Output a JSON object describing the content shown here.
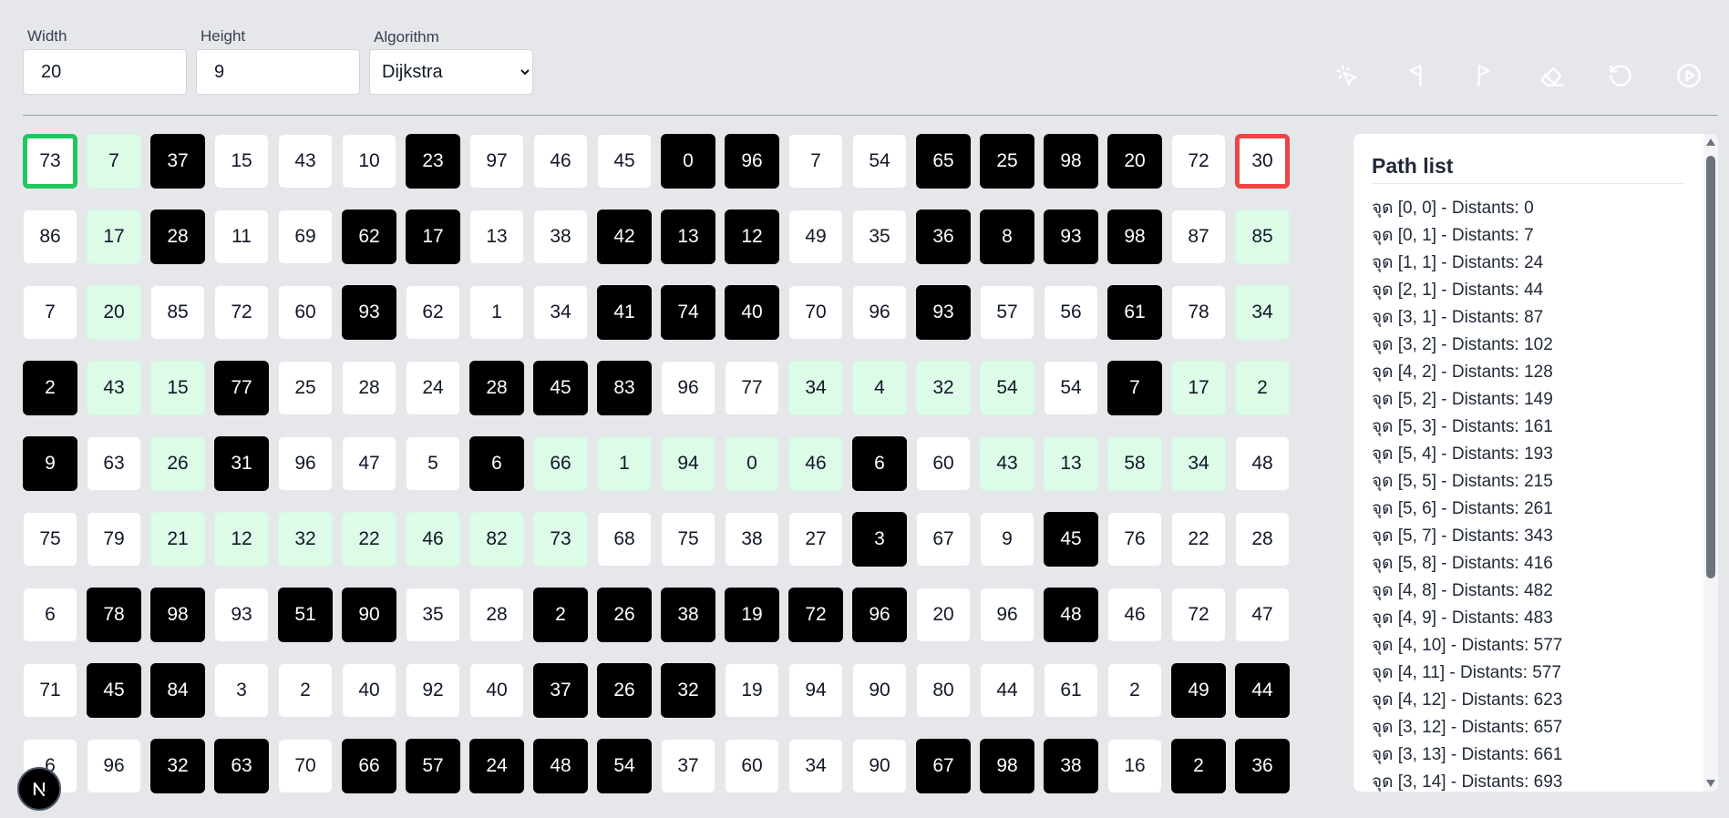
{
  "controls": {
    "width_label": "Width",
    "width_value": "20",
    "height_label": "Height",
    "height_value": "9",
    "algorithm_label": "Algorithm",
    "algorithm_value": "Dijkstra"
  },
  "toolbar": [
    {
      "name": "select-tool-button",
      "icon": "cursor-click-icon",
      "color": "#1f2937"
    },
    {
      "name": "start-flag-button",
      "icon": "flag-triangle-icon",
      "color": "#9ca3af"
    },
    {
      "name": "end-flag-button",
      "icon": "flag-icon",
      "color": "#9ca3af"
    },
    {
      "name": "eraser-button",
      "icon": "eraser-icon",
      "color": "#c70000"
    },
    {
      "name": "reset-button",
      "icon": "rotate-ccw-icon",
      "color": "#f5b100"
    },
    {
      "name": "run-button",
      "icon": "play-circle-icon",
      "color": "#3b82f6"
    }
  ],
  "grid": {
    "legend": {
      "start": "#22c55e",
      "end": "#ef4444",
      "wall": "#000000",
      "path": "#dcfce7"
    },
    "rows": [
      [
        [
          73,
          "start"
        ],
        [
          7,
          "path"
        ],
        [
          37,
          "wall"
        ],
        [
          15,
          ""
        ],
        [
          43,
          ""
        ],
        [
          10,
          ""
        ],
        [
          23,
          "wall"
        ],
        [
          97,
          ""
        ],
        [
          46,
          ""
        ],
        [
          45,
          ""
        ],
        [
          0,
          "wall"
        ],
        [
          96,
          "wall"
        ],
        [
          7,
          ""
        ],
        [
          54,
          ""
        ],
        [
          65,
          "wall"
        ],
        [
          25,
          "wall"
        ],
        [
          98,
          "wall"
        ],
        [
          20,
          "wall"
        ],
        [
          72,
          ""
        ],
        [
          30,
          "end"
        ]
      ],
      [
        [
          86,
          ""
        ],
        [
          17,
          "path"
        ],
        [
          28,
          "wall"
        ],
        [
          11,
          ""
        ],
        [
          69,
          ""
        ],
        [
          62,
          "wall"
        ],
        [
          17,
          "wall"
        ],
        [
          13,
          ""
        ],
        [
          38,
          ""
        ],
        [
          42,
          "wall"
        ],
        [
          13,
          "wall"
        ],
        [
          12,
          "wall"
        ],
        [
          49,
          ""
        ],
        [
          35,
          ""
        ],
        [
          36,
          "wall"
        ],
        [
          8,
          "wall"
        ],
        [
          93,
          "wall"
        ],
        [
          98,
          "wall"
        ],
        [
          87,
          ""
        ],
        [
          85,
          "path"
        ]
      ],
      [
        [
          7,
          ""
        ],
        [
          20,
          "path"
        ],
        [
          85,
          ""
        ],
        [
          72,
          ""
        ],
        [
          60,
          ""
        ],
        [
          93,
          "wall"
        ],
        [
          62,
          ""
        ],
        [
          1,
          ""
        ],
        [
          34,
          ""
        ],
        [
          41,
          "wall"
        ],
        [
          74,
          "wall"
        ],
        [
          40,
          "wall"
        ],
        [
          70,
          ""
        ],
        [
          96,
          ""
        ],
        [
          93,
          "wall"
        ],
        [
          57,
          ""
        ],
        [
          56,
          ""
        ],
        [
          61,
          "wall"
        ],
        [
          78,
          ""
        ],
        [
          34,
          "path"
        ]
      ],
      [
        [
          2,
          "wall"
        ],
        [
          43,
          "path"
        ],
        [
          15,
          "path"
        ],
        [
          77,
          "wall"
        ],
        [
          25,
          ""
        ],
        [
          28,
          ""
        ],
        [
          24,
          ""
        ],
        [
          28,
          "wall"
        ],
        [
          45,
          "wall"
        ],
        [
          83,
          "wall"
        ],
        [
          96,
          ""
        ],
        [
          77,
          ""
        ],
        [
          34,
          "path"
        ],
        [
          4,
          "path"
        ],
        [
          32,
          "path"
        ],
        [
          54,
          "path"
        ],
        [
          54,
          ""
        ],
        [
          7,
          "wall"
        ],
        [
          17,
          "path"
        ],
        [
          2,
          "path"
        ]
      ],
      [
        [
          9,
          "wall"
        ],
        [
          63,
          ""
        ],
        [
          26,
          "path"
        ],
        [
          31,
          "wall"
        ],
        [
          96,
          ""
        ],
        [
          47,
          ""
        ],
        [
          5,
          ""
        ],
        [
          6,
          "wall"
        ],
        [
          66,
          "path"
        ],
        [
          1,
          "path"
        ],
        [
          94,
          "path"
        ],
        [
          0,
          "path"
        ],
        [
          46,
          "path"
        ],
        [
          6,
          "wall"
        ],
        [
          60,
          ""
        ],
        [
          43,
          "path"
        ],
        [
          13,
          "path"
        ],
        [
          58,
          "path"
        ],
        [
          34,
          "path"
        ],
        [
          48,
          ""
        ]
      ],
      [
        [
          75,
          ""
        ],
        [
          79,
          ""
        ],
        [
          21,
          "path"
        ],
        [
          12,
          "path"
        ],
        [
          32,
          "path"
        ],
        [
          22,
          "path"
        ],
        [
          46,
          "path"
        ],
        [
          82,
          "path"
        ],
        [
          73,
          "path"
        ],
        [
          68,
          ""
        ],
        [
          75,
          ""
        ],
        [
          38,
          ""
        ],
        [
          27,
          ""
        ],
        [
          3,
          "wall"
        ],
        [
          67,
          ""
        ],
        [
          9,
          ""
        ],
        [
          45,
          "wall"
        ],
        [
          76,
          ""
        ],
        [
          22,
          ""
        ],
        [
          28,
          ""
        ]
      ],
      [
        [
          6,
          ""
        ],
        [
          78,
          "wall"
        ],
        [
          98,
          "wall"
        ],
        [
          93,
          ""
        ],
        [
          51,
          "wall"
        ],
        [
          90,
          "wall"
        ],
        [
          35,
          ""
        ],
        [
          28,
          ""
        ],
        [
          2,
          "wall"
        ],
        [
          26,
          "wall"
        ],
        [
          38,
          "wall"
        ],
        [
          19,
          "wall"
        ],
        [
          72,
          "wall"
        ],
        [
          96,
          "wall"
        ],
        [
          20,
          ""
        ],
        [
          96,
          ""
        ],
        [
          48,
          "wall"
        ],
        [
          46,
          ""
        ],
        [
          72,
          ""
        ],
        [
          47,
          ""
        ]
      ],
      [
        [
          71,
          ""
        ],
        [
          45,
          "wall"
        ],
        [
          84,
          "wall"
        ],
        [
          3,
          ""
        ],
        [
          2,
          ""
        ],
        [
          40,
          ""
        ],
        [
          92,
          ""
        ],
        [
          40,
          ""
        ],
        [
          37,
          "wall"
        ],
        [
          26,
          "wall"
        ],
        [
          32,
          "wall"
        ],
        [
          19,
          ""
        ],
        [
          94,
          ""
        ],
        [
          90,
          ""
        ],
        [
          80,
          ""
        ],
        [
          44,
          ""
        ],
        [
          61,
          ""
        ],
        [
          2,
          ""
        ],
        [
          49,
          "wall"
        ],
        [
          44,
          "wall"
        ]
      ],
      [
        [
          6,
          ""
        ],
        [
          96,
          ""
        ],
        [
          32,
          "wall"
        ],
        [
          63,
          "wall"
        ],
        [
          70,
          ""
        ],
        [
          66,
          "wall"
        ],
        [
          57,
          "wall"
        ],
        [
          24,
          "wall"
        ],
        [
          48,
          "wall"
        ],
        [
          54,
          "wall"
        ],
        [
          37,
          ""
        ],
        [
          60,
          ""
        ],
        [
          34,
          ""
        ],
        [
          90,
          ""
        ],
        [
          67,
          "wall"
        ],
        [
          98,
          "wall"
        ],
        [
          38,
          "wall"
        ],
        [
          16,
          ""
        ],
        [
          2,
          "wall"
        ],
        [
          36,
          "wall"
        ]
      ]
    ]
  },
  "path_panel": {
    "title": "Path list",
    "items": [
      "จุด [0, 0] - Distants: 0",
      "จุด [0, 1] - Distants: 7",
      "จุด [1, 1] - Distants: 24",
      "จุด [2, 1] - Distants: 44",
      "จุด [3, 1] - Distants: 87",
      "จุด [3, 2] - Distants: 102",
      "จุด [4, 2] - Distants: 128",
      "จุด [5, 2] - Distants: 149",
      "จุด [5, 3] - Distants: 161",
      "จุด [5, 4] - Distants: 193",
      "จุด [5, 5] - Distants: 215",
      "จุด [5, 6] - Distants: 261",
      "จุด [5, 7] - Distants: 343",
      "จุด [5, 8] - Distants: 416",
      "จุด [4, 8] - Distants: 482",
      "จุด [4, 9] - Distants: 483",
      "จุด [4, 10] - Distants: 577",
      "จุด [4, 11] - Distants: 577",
      "จุด [4, 12] - Distants: 623",
      "จุด [3, 12] - Distants: 657",
      "จุด [3, 13] - Distants: 661",
      "จุด [3, 14] - Distants: 693"
    ]
  },
  "badge": {
    "icon": "nextjs-logo-icon"
  }
}
